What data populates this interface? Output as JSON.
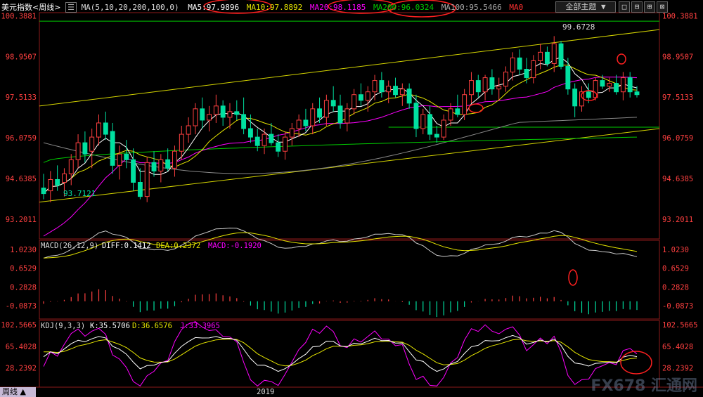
{
  "header": {
    "title": "美元指数<周线>",
    "ma_params": "MA(5,10,20,200,100,0)",
    "ma5": "MA5:97.9896",
    "ma10": "MA10:97.8892",
    "ma20": "MA20:98.1185",
    "ma200": "MA200:96.0324",
    "ma100": "MA100:95.5466",
    "ma0": "MA0",
    "theme_label": "全部主题 ▼",
    "window_buttons": [
      "□",
      "⊟",
      "⊞",
      "⊠"
    ]
  },
  "footer": {
    "tab_label": "周线 ▲",
    "year_label": "2019",
    "watermark": "FX678 汇通网"
  },
  "colors": {
    "up": "#ff4040",
    "down": "#00e0a0",
    "ma5": "#ffffff",
    "ma10": "#e6e600",
    "ma20": "#ff00ff",
    "ma200": "#00cc00",
    "ma100": "#888888",
    "channel": "#d4d400",
    "annotation": "#ff2020"
  },
  "chart_data": [
    {
      "type": "candlestick",
      "title": "美元指数<周线>",
      "ylim": [
        92.5,
        100.5
      ],
      "y_ticks": [
        "100.3881",
        "98.9507",
        "97.5133",
        "96.0759",
        "94.6385",
        "93.2011"
      ],
      "annotations": [
        "99.6728",
        "93.7121"
      ],
      "ohlc": [
        [
          94.3,
          94.8,
          93.9,
          94.1
        ],
        [
          94.2,
          94.9,
          93.8,
          94.6
        ],
        [
          94.6,
          95.1,
          94.2,
          94.4
        ],
        [
          94.5,
          95.0,
          94.0,
          94.8
        ],
        [
          94.8,
          95.5,
          94.4,
          95.3
        ],
        [
          95.3,
          96.2,
          95.0,
          95.9
        ],
        [
          95.9,
          96.3,
          95.2,
          95.5
        ],
        [
          95.6,
          96.4,
          95.0,
          96.1
        ],
        [
          96.1,
          96.9,
          95.8,
          96.6
        ],
        [
          96.6,
          97.0,
          96.0,
          96.2
        ],
        [
          96.3,
          96.6,
          94.8,
          95.1
        ],
        [
          95.1,
          95.8,
          94.6,
          95.5
        ],
        [
          95.5,
          96.0,
          95.0,
          95.3
        ],
        [
          95.3,
          95.7,
          94.2,
          94.5
        ],
        [
          94.5,
          95.0,
          93.9,
          94.0
        ],
        [
          94.0,
          95.4,
          93.8,
          95.2
        ],
        [
          95.2,
          95.6,
          94.7,
          94.9
        ],
        [
          94.9,
          95.5,
          94.5,
          95.3
        ],
        [
          95.3,
          95.7,
          94.9,
          95.0
        ],
        [
          95.0,
          95.8,
          94.7,
          95.6
        ],
        [
          95.6,
          96.5,
          95.3,
          96.2
        ],
        [
          96.2,
          96.8,
          95.9,
          96.5
        ],
        [
          96.5,
          97.3,
          96.2,
          97.1
        ],
        [
          97.1,
          97.5,
          96.4,
          96.7
        ],
        [
          96.7,
          97.2,
          96.3,
          96.9
        ],
        [
          96.9,
          97.6,
          96.6,
          97.2
        ],
        [
          97.2,
          97.4,
          96.5,
          96.8
        ],
        [
          96.8,
          97.3,
          96.4,
          97.0
        ],
        [
          97.0,
          97.4,
          96.7,
          96.9
        ],
        [
          96.9,
          97.5,
          96.2,
          96.4
        ],
        [
          96.4,
          96.9,
          95.9,
          96.1
        ],
        [
          96.1,
          96.4,
          95.6,
          95.8
        ],
        [
          95.8,
          96.4,
          95.5,
          96.2
        ],
        [
          96.2,
          96.6,
          95.8,
          95.9
        ],
        [
          95.9,
          96.2,
          95.4,
          95.6
        ],
        [
          95.6,
          96.3,
          95.3,
          96.1
        ],
        [
          96.1,
          96.6,
          95.8,
          96.4
        ],
        [
          96.4,
          96.9,
          96.1,
          96.7
        ],
        [
          96.7,
          97.1,
          96.3,
          96.5
        ],
        [
          96.5,
          97.3,
          96.2,
          97.1
        ],
        [
          97.1,
          97.5,
          96.6,
          96.8
        ],
        [
          96.8,
          97.6,
          96.5,
          97.4
        ],
        [
          97.4,
          97.9,
          97.0,
          97.2
        ],
        [
          97.2,
          97.6,
          96.4,
          96.6
        ],
        [
          96.6,
          97.3,
          96.3,
          97.1
        ],
        [
          97.1,
          97.8,
          96.9,
          97.6
        ],
        [
          97.6,
          98.0,
          97.2,
          97.4
        ],
        [
          97.4,
          97.9,
          97.0,
          97.7
        ],
        [
          97.7,
          98.3,
          97.4,
          98.1
        ],
        [
          98.1,
          98.4,
          97.5,
          97.7
        ],
        [
          97.7,
          98.1,
          97.3,
          97.9
        ],
        [
          97.9,
          98.2,
          97.5,
          97.6
        ],
        [
          97.6,
          98.0,
          97.2,
          97.8
        ],
        [
          97.8,
          98.0,
          97.1,
          97.3
        ],
        [
          97.3,
          97.6,
          96.1,
          96.4
        ],
        [
          96.4,
          97.1,
          96.2,
          96.9
        ],
        [
          96.9,
          97.2,
          96.0,
          96.2
        ],
        [
          96.2,
          96.5,
          95.9,
          96.1
        ],
        [
          96.1,
          96.9,
          96.0,
          96.7
        ],
        [
          96.7,
          97.3,
          96.5,
          97.1
        ],
        [
          97.1,
          97.6,
          96.8,
          96.9
        ],
        [
          96.9,
          97.8,
          96.7,
          97.6
        ],
        [
          97.6,
          98.4,
          97.3,
          98.1
        ],
        [
          98.1,
          98.3,
          97.5,
          97.7
        ],
        [
          97.7,
          98.3,
          97.4,
          98.2
        ],
        [
          98.2,
          98.5,
          97.6,
          97.8
        ],
        [
          97.8,
          98.2,
          97.4,
          97.9
        ],
        [
          97.9,
          98.6,
          97.7,
          98.4
        ],
        [
          98.4,
          99.1,
          98.1,
          98.9
        ],
        [
          98.9,
          99.2,
          98.3,
          98.5
        ],
        [
          98.5,
          98.9,
          98.0,
          98.2
        ],
        [
          98.2,
          99.0,
          98.0,
          98.8
        ],
        [
          98.8,
          99.4,
          98.5,
          99.1
        ],
        [
          99.1,
          99.3,
          98.6,
          98.7
        ],
        [
          98.7,
          99.67,
          98.4,
          99.4
        ],
        [
          99.4,
          99.5,
          98.5,
          98.6
        ],
        [
          98.6,
          98.9,
          97.6,
          97.8
        ],
        [
          97.8,
          98.0,
          96.8,
          97.2
        ],
        [
          97.2,
          97.9,
          97.0,
          97.7
        ],
        [
          97.7,
          98.0,
          97.3,
          97.5
        ],
        [
          97.5,
          98.2,
          97.4,
          98.1
        ],
        [
          98.1,
          98.3,
          97.8,
          97.9
        ],
        [
          97.9,
          98.2,
          97.7,
          98.0
        ],
        [
          98.0,
          98.3,
          97.6,
          97.7
        ],
        [
          97.7,
          98.4,
          97.4,
          98.2
        ],
        [
          98.2,
          98.4,
          97.5,
          97.7
        ],
        [
          97.7,
          97.9,
          97.5,
          97.6
        ]
      ]
    },
    {
      "type": "macd",
      "title": "MACD(26,12,9)",
      "diff": "DIFF:0.1412",
      "dea": "DEA:0.2372",
      "macd": "MACD:-0.1920",
      "ylim": [
        -0.35,
        1.2
      ],
      "y_ticks": [
        "1.0230",
        "0.6529",
        "0.2828",
        "-0.0873"
      ]
    },
    {
      "type": "kdj",
      "title": "KDJ(9,3,3)",
      "k": "K:35.5706",
      "d": "D:36.6576",
      "j": "J:33.3965",
      "ylim": [
        -5,
        110
      ],
      "y_ticks": [
        "102.5665",
        "65.4028",
        "28.2392"
      ]
    }
  ]
}
